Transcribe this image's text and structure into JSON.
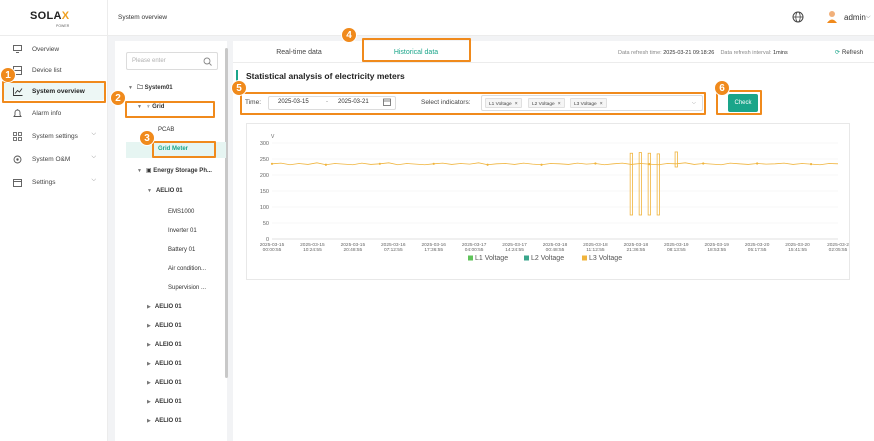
{
  "brand": {
    "logo_main": "SOLA",
    "logo_accent": "X",
    "logo_sub": "POWER"
  },
  "nav": {
    "items": [
      {
        "label": "Overview",
        "icon": "monitor-icon"
      },
      {
        "label": "Device list",
        "icon": "device-list-icon"
      },
      {
        "label": "System overview",
        "icon": "chart-line-icon",
        "active": true
      },
      {
        "label": "Alarm info",
        "icon": "alarm-icon"
      },
      {
        "label": "System settings",
        "icon": "grid-settings-icon",
        "expandable": true
      },
      {
        "label": "System O&M",
        "icon": "om-icon",
        "expandable": true
      },
      {
        "label": "Settings",
        "icon": "calendar-settings-icon",
        "expandable": true
      }
    ]
  },
  "header": {
    "title": "System overview",
    "user": "admin"
  },
  "tree": {
    "search_placeholder": "Please enter",
    "system": "System01",
    "grid": "Grid",
    "pcab": "PCAB",
    "grid_meter": "Grid Meter",
    "energy_storage": "Energy Storage Ph...",
    "aelio_expanded": "AELIO 01",
    "aelio_children": [
      "EMS1000",
      "Inverter 01",
      "Battery 01",
      "Air condition...",
      "Supervision ..."
    ],
    "aelio_collapsed": [
      "AELIO 01",
      "AELIO 01",
      "ALEIO 01",
      "AELIO 01",
      "AELIO 01",
      "AELIO 01",
      "AELIO 01"
    ]
  },
  "tabs": {
    "realtime": "Real-time data",
    "historical": "Historical data"
  },
  "refresh": {
    "time_label": "Data refresh time:",
    "time_value": "2025-03-21 09:18:26",
    "interval_label": "Data refresh interval:",
    "interval_value": "1mins",
    "refresh_label": "Refresh"
  },
  "section": {
    "title": "Statistical analysis of electricity meters",
    "time_label": "Time:",
    "date_from": "2025-03-15",
    "date_sep": "-",
    "date_to": "2025-03-21",
    "indicators_label": "Select indicators:",
    "tags": [
      "L1 Voltage",
      "L2 Voltage",
      "L3 Voltage"
    ],
    "check_label": "Check"
  },
  "annotations": [
    "1",
    "2",
    "3",
    "4",
    "5",
    "6"
  ],
  "colors": {
    "accent": "#1aa58a",
    "annotation": "#f08a1c",
    "l1": "#5fc35a",
    "l2": "#3aa68c",
    "l3": "#f0b43c"
  },
  "chart_data": {
    "type": "line",
    "title": "",
    "ylabel": "V",
    "xlabel": "",
    "ylim": [
      0,
      300
    ],
    "yticks": [
      0,
      50,
      100,
      150,
      200,
      250,
      300
    ],
    "x_ticks": [
      [
        "2025-03-15",
        "00:00:55"
      ],
      [
        "2025-03-15",
        "10:24:55"
      ],
      [
        "2025-03-15",
        "20:48:55"
      ],
      [
        "2025-03-16",
        "07:12:55"
      ],
      [
        "2025-03-16",
        "17:36:55"
      ],
      [
        "2025-03-17",
        "04:00:55"
      ],
      [
        "2025-03-17",
        "14:24:55"
      ],
      [
        "2025-03-18",
        "00:48:55"
      ],
      [
        "2025-03-18",
        "11:12:55"
      ],
      [
        "2025-03-18",
        "21:36:55"
      ],
      [
        "2025-03-19",
        "08:13:55"
      ],
      [
        "2025-03-19",
        "18:53:55"
      ],
      [
        "2025-03-20",
        "05:17:55"
      ],
      [
        "2025-03-20",
        "15:41:55"
      ],
      [
        "2025-03-2",
        "02:05:55"
      ]
    ],
    "legend": [
      "L1 Voltage",
      "L2 Voltage",
      "L3 Voltage"
    ],
    "legend_position": "bottom",
    "series": [
      {
        "name": "L3 Voltage",
        "values": [
          235,
          237,
          232,
          236,
          233,
          238,
          232,
          236,
          234,
          232,
          237,
          233,
          235,
          238,
          232,
          236,
          234,
          232,
          235,
          237,
          233,
          236,
          234,
          238,
          232,
          235,
          236,
          233,
          237,
          234,
          232,
          236,
          235,
          233,
          237,
          234,
          236,
          232,
          235,
          237,
          233,
          236,
          234,
          232,
          236,
          235,
          238,
          233,
          236,
          234,
          232,
          237,
          235,
          233,
          236,
          234,
          235,
          237,
          233,
          236,
          234,
          232,
          236,
          235
        ]
      }
    ],
    "dropout_spikes": [
      {
        "index": 40,
        "min": 75,
        "max": 268
      },
      {
        "index": 41,
        "min": 75,
        "max": 270
      },
      {
        "index": 42,
        "min": 75,
        "max": 268
      },
      {
        "index": 43,
        "min": 75,
        "max": 266
      },
      {
        "index": 45,
        "min": 225,
        "max": 272
      }
    ]
  }
}
